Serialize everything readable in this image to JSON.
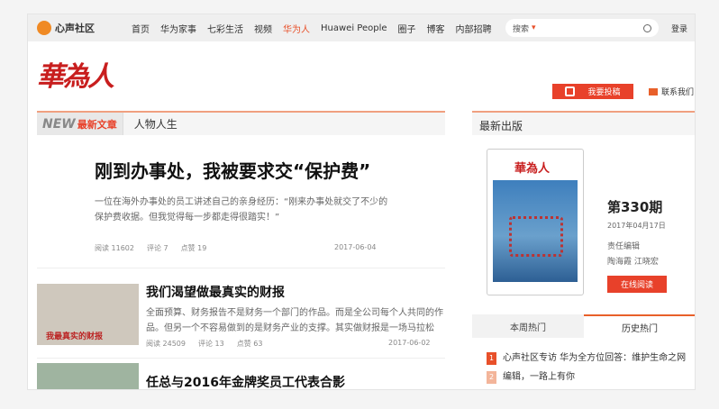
{
  "nav": {
    "logo": "心声社区",
    "items": [
      "首页",
      "华为家事",
      "七彩生活",
      "视频",
      "华为人",
      "Huawei People",
      "圈子",
      "博客",
      "内部招聘"
    ],
    "active": 4,
    "search_placeholder": "搜索",
    "login": "登录"
  },
  "brand": "華為人",
  "actions": {
    "submit": "我要投稿",
    "contact": "联系我们"
  },
  "tabs": {
    "new": "NEW",
    "latest": "最新文章",
    "people": "人物人生"
  },
  "articles": [
    {
      "title": "刚到办事处，我被要求交“保护费”",
      "summary": "一位在海外办事处的员工讲述自己的亲身经历：“刚来办事处就交了不少的保护费收据。但我觉得每一步都走得很踏实！”",
      "reads": "阅读 11602",
      "comments": "评论 7",
      "likes": "点赞 19",
      "date": "2017-06-04"
    },
    {
      "title": "我们渴望做最真实的财报",
      "summary": "全面预算、财务报告不是财务一个部门的作品。而是全公司每个人共同的作品。但另一个不容易做到的是财务产业的支撑。其实做财报是一场马拉松",
      "reads": "阅读 24509",
      "comments": "评论 13",
      "likes": "点赞 63",
      "date": "2017-06-02",
      "thumb_caption": "我最真实的财报"
    },
    {
      "title": "任总与2016年金牌奖员工代表合影"
    }
  ],
  "right": {
    "heading": "最新出版",
    "magazine": "華為人",
    "issue": "第330期",
    "date": "2017年04月17日",
    "editor_label": "责任编辑",
    "editors": "陶海霞 江晓宏",
    "read_button": "在线阅读",
    "hot_tabs": [
      "本周热门",
      "历史热门"
    ],
    "hot_list": [
      {
        "rank": "1",
        "text": "心声社区专访 华为全方位回答：维护生命之网"
      },
      {
        "rank": "2",
        "text": "编辑，一路上有你"
      }
    ]
  }
}
